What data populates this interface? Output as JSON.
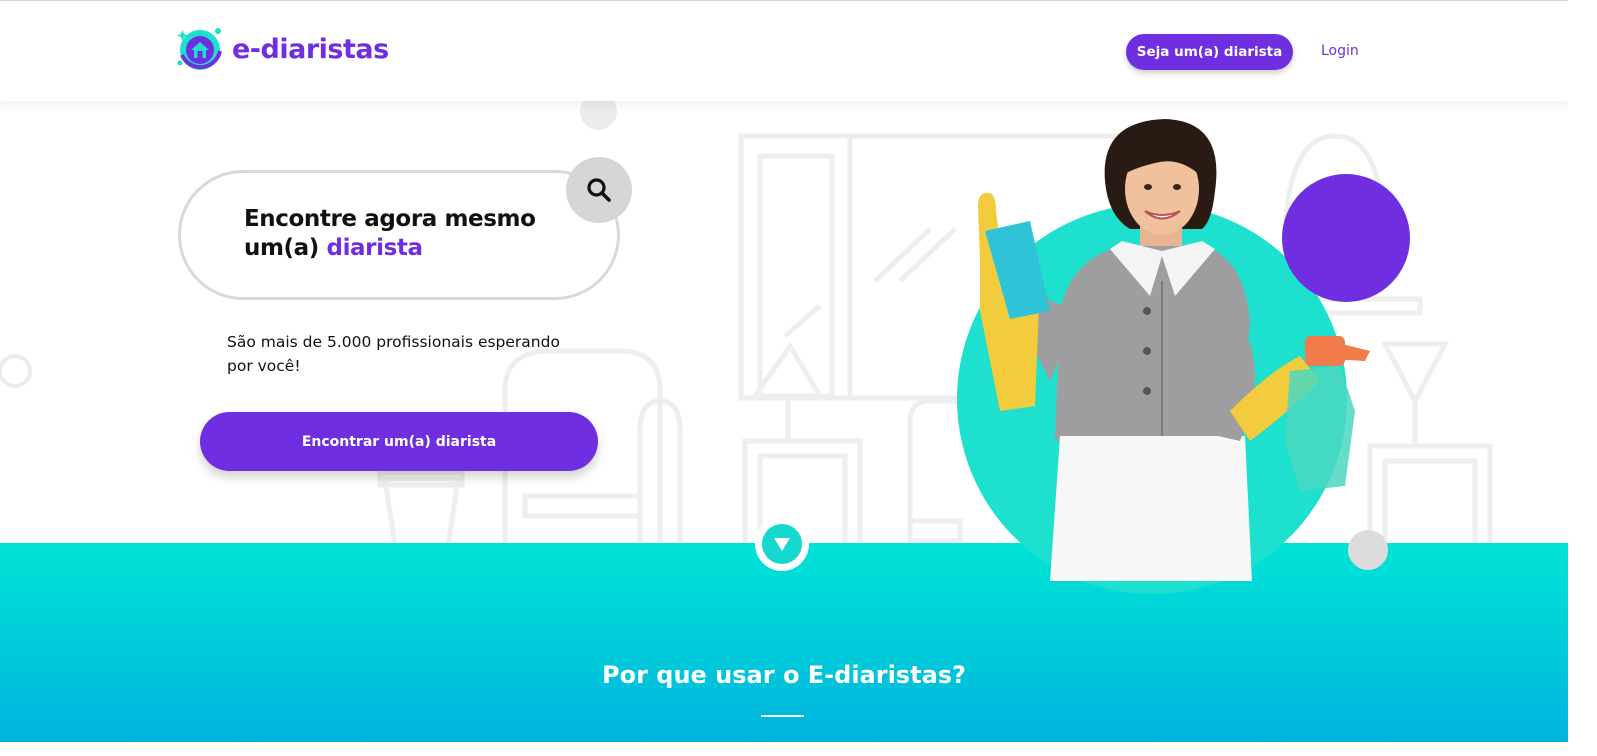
{
  "header": {
    "brand": "e-diaristas",
    "cta_label": "Seja um(a) diarista",
    "login_label": "Login"
  },
  "hero": {
    "title_line1": "Encontre agora mesmo",
    "title_line2_prefix": "um(a) ",
    "title_line2_accent": "diarista",
    "subtitle": "São mais de 5.000 profissionais esperando por você!",
    "find_button_label": "Encontrar um(a) diarista"
  },
  "section": {
    "title": "Por que usar o E-diaristas?"
  },
  "icons": {
    "logo": "house-logo-icon",
    "search": "search-icon",
    "scroll_down": "chevron-down-icon"
  },
  "colors": {
    "brand_purple": "#6f2fe0",
    "teal": "#1de0cf",
    "band_top": "#00e3d6",
    "band_bottom": "#00b2df",
    "grey_circle": "#d6d6d8"
  }
}
